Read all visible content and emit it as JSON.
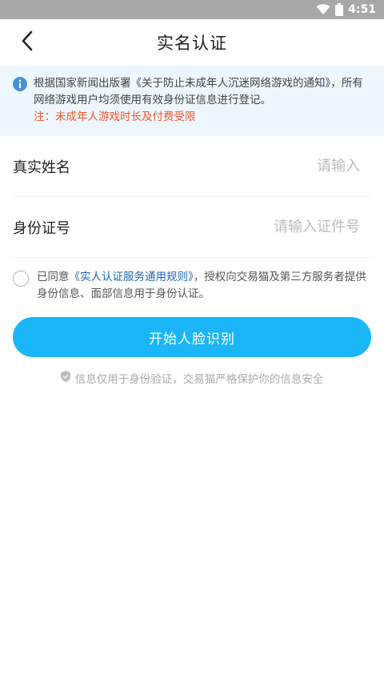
{
  "status_bar": {
    "time": "4:51",
    "icons": [
      "wifi-icon",
      "battery-icon"
    ]
  },
  "nav": {
    "title": "实名认证",
    "back_icon": "back-arrow-icon"
  },
  "notice": {
    "icon": "info-icon",
    "text": "根据国家新闻出版署《关于防止未成年人沉迷网络游戏的通知》，所有网络游戏用户均须使用有效身份证信息进行登记。",
    "warning": "注：未成年人游戏时长及付费受限",
    "colors": {
      "background": "#eef7fd",
      "warning": "#f0582e",
      "icon": "#4a90d9"
    }
  },
  "form": {
    "name": {
      "label": "真实姓名",
      "placeholder": "请输入",
      "value": ""
    },
    "id_number": {
      "label": "身份证号",
      "placeholder": "请输入证件号",
      "value": ""
    }
  },
  "agreement": {
    "checked": false,
    "prefix": "已同意",
    "link": "《实人认证服务通用规则》",
    "suffix": "，授权向交易猫及第三方服务者提供身份信息、面部信息用于身份认证。"
  },
  "submit": {
    "label": "开始人脸识别",
    "color": "#1ab6f8"
  },
  "security_note": {
    "icon": "shield-icon",
    "text": "信息仅用于身份验证，交易猫严格保护你的信息安全"
  }
}
